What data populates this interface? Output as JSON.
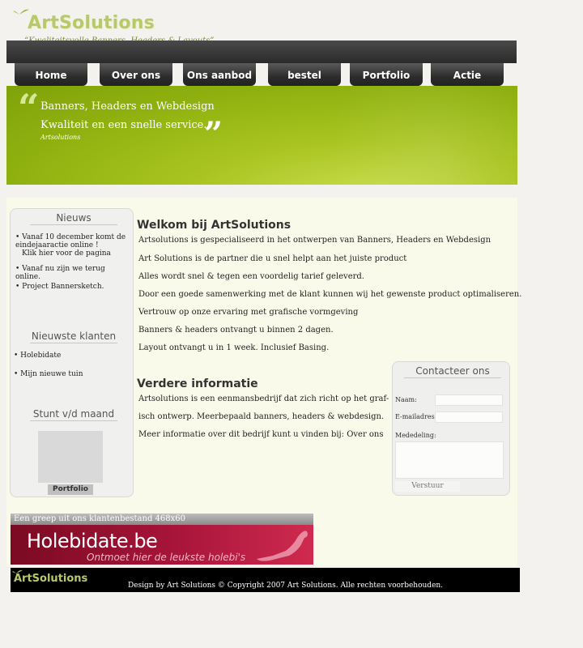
{
  "logo": {
    "brand": "ArtSolutions",
    "tagline": "“Kwaliteitsvolle Banners, Headers & Layouts”"
  },
  "nav": [
    "Home",
    "Over ons",
    "Ons aanbod",
    "bestel",
    "Portfolio",
    "Actie"
  ],
  "banner": {
    "line1": "Banners, Headers en Webdesign",
    "line2": "Kwaliteit en een snelle service.",
    "signature": "Artsolutions",
    "open_quote": "“",
    "close_quote": "”"
  },
  "sidebar": {
    "news_title": "Nieuws",
    "news": [
      "• Vanaf 10 december komt de eindejaaractie online !",
      "Klik hier voor de pagina",
      "• Vanaf nu zijn we terug online.",
      "• Project Bannersketch."
    ],
    "clients_title": "Nieuwste klanten",
    "clients": [
      "• Holebidate",
      "• Mijn nieuwe tuin"
    ],
    "stunt_title": "Stunt v/d maand",
    "stunt_button": "Portfolio"
  },
  "main": {
    "welcome_title": "Welkom bij ArtSolutions",
    "welcome_lines": [
      "Artsolutions is gespecialiseerd in het ontwerpen van Banners, Headers en Webdesign",
      "Art Solutions is de partner die u snel helpt aan het juiste product",
      "Alles wordt snel & tegen een voordelig tarief geleverd.",
      "Door een goede samenwerking met de klant kunnen wij het gewenste product optimaliseren.",
      "Vertrouw op onze ervaring met grafische vormgeving",
      "Banners & headers ontvangt u binnen 2 dagen.",
      "Layout ontvangt u in 1 week. Inclusief Basing."
    ],
    "info_title": "Verdere informatie",
    "info_lines": [
      "Artsolutions is een eenmansbedrijf dat zich richt op het graf-",
      "isch ontwerp. Meerbepaald banners, headers & webdesign.",
      "Meer informatie over dit bedrijf kunt u vinden bij: Over ons"
    ]
  },
  "contact": {
    "title": "Contacteer ons",
    "name_label": "Naam:",
    "email_label": "E-mailadres:",
    "message_label": "Mededeling:",
    "submit": "Verstuur"
  },
  "ad": {
    "caption": "Een greep uit ons klantenbestand 468x60",
    "headline": "Holebidate.be",
    "slogan": "Ontmoet hier de leukste holebi's"
  },
  "footer": {
    "logo": "ArtSolutions",
    "copyright": "Design by Art Solutions © Copyright 2007 Art Solutions. Alle rechten voorbehouden."
  },
  "colors": {
    "accent_green": "#a9c420",
    "logo_green": "#b8c96a",
    "nav_dark": "#2c2c2c",
    "content_bg": "#fafaeb",
    "ad_red": "#a8153a"
  }
}
